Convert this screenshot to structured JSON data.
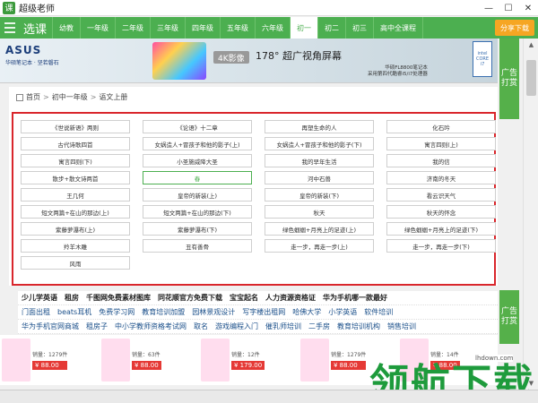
{
  "window": {
    "title": "超级老师",
    "controls": [
      "—",
      "☐",
      "✕"
    ]
  },
  "nav": {
    "logo": "选课",
    "tabs": [
      "幼教",
      "一年级",
      "二年级",
      "三年级",
      "四年级",
      "五年级",
      "六年级",
      "初一",
      "初二",
      "初三",
      "高中全课程"
    ],
    "active_tab": "初一",
    "share_label": "分享下载"
  },
  "ad_banner": {
    "brand": "ASUS",
    "brand_sub": "华硕笔记本 · 坚若磐石",
    "badge": "4K影像",
    "headline": "178° 超广视角屏幕",
    "small_lines": [
      "华硕FL8800笔记本",
      "采用第四代酷睿i5/i7处理器"
    ],
    "intel": "intel CORE i7"
  },
  "side_ads": [
    "广告打赏",
    "广告打赏"
  ],
  "breadcrumb": [
    "首页",
    "初中一年级",
    "语文上册"
  ],
  "lessons": [
    "《世说新语》两则",
    "《论语》十二章",
    "再塑生命的人",
    "化石吟",
    "古代诗歌四首",
    "女娲造人+冒孩子和他的影子(上)",
    "女娲造人+冒孩子和他的影子(下)",
    "寓言四则(上)",
    "寓言四则(下)",
    "小圣施威降大圣",
    "我的早年生活",
    "我的信",
    "散步+散文诗两首",
    "春",
    "河中石兽",
    "济南的冬天",
    "王几何",
    "皇帝的新装(上)",
    "皇帝的新装(下)",
    "看云识天气",
    "短文两篇+在山的那边(上)",
    "短文两篇+在山的那边(下)",
    "秋天",
    "秋天的怀念",
    "紫藤萝瀑布(上)",
    "紫藤萝瀑布(下)",
    "绿色蝈蝈+月亮上的足迹(上)",
    "绿色蝈蝈+月亮上的足迹(下)",
    "羚羊木雕",
    "丑有善骨",
    "走一步，再走一步(上)",
    "走一步，再走一步(下)",
    "风雨"
  ],
  "highlighted_lesson": "春",
  "link_rows": [
    [
      "少儿学英语",
      "租房",
      "千图网免费素材图库",
      "同花顺官方免费下载",
      "宝宝起名",
      "人力资源资格证",
      "华为手机哪一款最好"
    ],
    [
      "门面出租",
      "beats耳机",
      "免费学习网",
      "教育培训加盟",
      "园林景观设计",
      "写字楼出租网",
      "哈佛大学",
      "小学英语",
      "软件培训"
    ],
    [
      "华为手机官网商城",
      "租房子",
      "中小学教师资格考试网",
      "取名",
      "游戏编程入门",
      "催乳师培训",
      "二手房",
      "教育培训机构",
      "销售培训"
    ]
  ],
  "products": [
    {
      "sales": "销量：1279件",
      "price": "¥ 88.00"
    },
    {
      "sales": "销量：63件",
      "price": "¥ 88.00"
    },
    {
      "sales": "销量：12件",
      "price": "¥ 179.00"
    },
    {
      "sales": "销量：1279件",
      "price": "¥ 88.00"
    },
    {
      "sales": "销量：14件",
      "price": "¥ 88.00"
    }
  ],
  "watermark": {
    "logo": "领航下载",
    "url": "lhdown.com"
  },
  "colors": {
    "nav_green": "#4caf50",
    "highlight_red": "#d9262c",
    "price_red": "#e53935"
  }
}
